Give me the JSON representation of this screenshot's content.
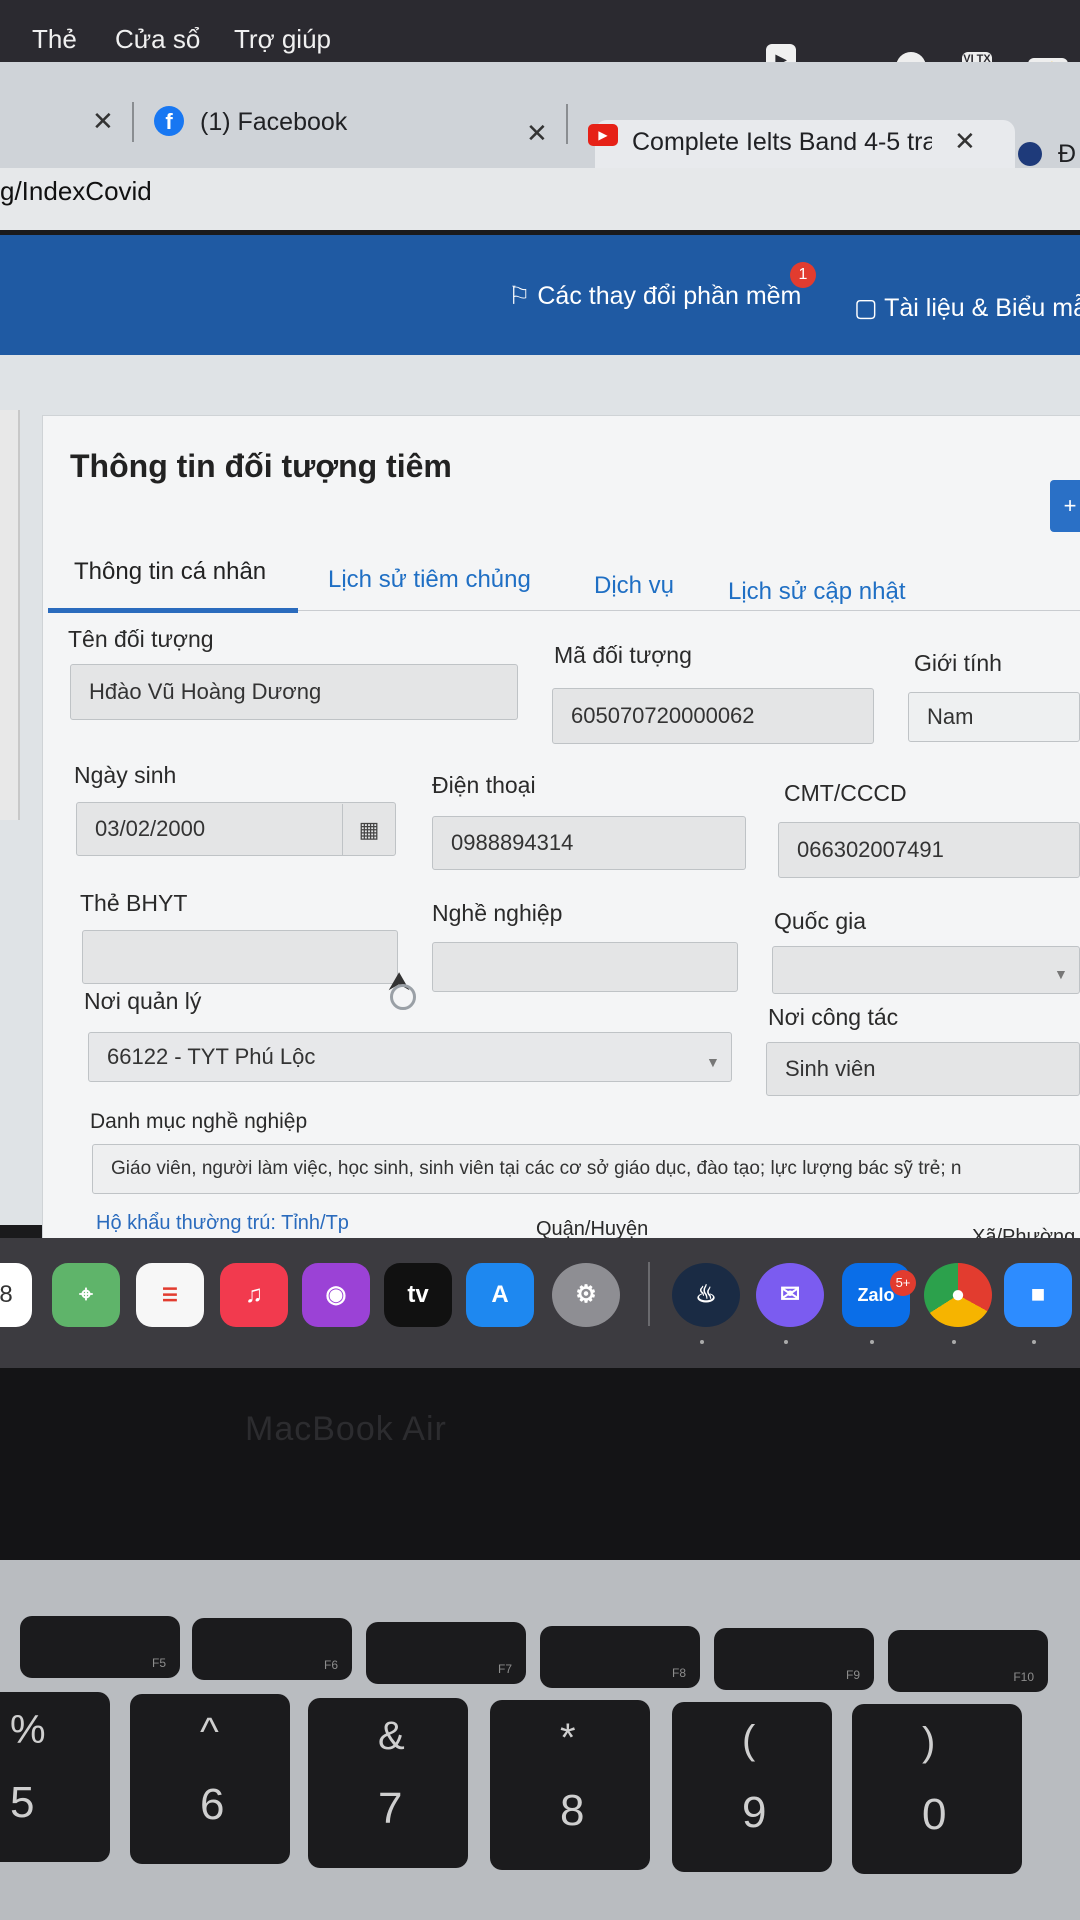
{
  "menubar": {
    "items": [
      "Thẻ",
      "Cửa sổ",
      "Trợ giúp"
    ],
    "input_source": "VI TX"
  },
  "browser": {
    "tabs": [
      {
        "title": "(1) Facebook",
        "icon": "facebook-icon"
      },
      {
        "title": "Complete Ielts Band 4-5 trac",
        "icon": "youtube-icon"
      },
      {
        "title": "Đ",
        "icon": "site-favicon"
      }
    ],
    "url": "g/IndexCovid"
  },
  "app_header": {
    "changes_link": "Các thay đổi phần mềm",
    "changes_badge": "1",
    "docs_link": "Tài liệu & Biểu mẫ"
  },
  "card": {
    "title": "Thông tin đối tượng tiêm",
    "tabs": [
      "Thông tin cá nhân",
      "Lịch sử tiêm chủng",
      "Dịch vụ",
      "Lịch sử cập nhật"
    ]
  },
  "form": {
    "ten_doi_tuong": {
      "label": "Tên đối tượng",
      "value": "Hđào Vũ Hoàng Dương"
    },
    "ma_doi_tuong": {
      "label": "Mã đối tượng",
      "value": "605070720000062"
    },
    "gioi_tinh": {
      "label": "Giới tính",
      "value": "Nam"
    },
    "ngay_sinh": {
      "label": "Ngày sinh",
      "value": "03/02/2000"
    },
    "dien_thoai": {
      "label": "Điện thoại",
      "value": "0988894314"
    },
    "cmt": {
      "label": "CMT/CCCD",
      "value": "066302007491"
    },
    "the_bhyt": {
      "label": "Thẻ BHYT",
      "value": ""
    },
    "nghe_nghiep": {
      "label": "Nghề nghiệp",
      "value": ""
    },
    "quoc_gia": {
      "label": "Quốc gia",
      "value": ""
    },
    "noi_quan_ly": {
      "label": "Nơi quản lý",
      "value": "66122 - TYT Phú Lộc"
    },
    "noi_cong_tac": {
      "label": "Nơi công tác",
      "value": "Sinh viên"
    },
    "danh_muc": {
      "label": "Danh mục nghề nghiệp",
      "value": "Giáo viên, người làm việc, học sinh, sinh viên tại các cơ sở giáo dục, đào tạo; lực lượng bác sỹ trẻ; n"
    },
    "ho_khau": {
      "label_tinh": "Hộ khẩu thường trú: Tỉnh/Tp",
      "label_huyen": "Quận/Huyện",
      "label_xa": "Xã/Phường"
    }
  },
  "dock": {
    "calendar_day": "8",
    "tv_label": "tv",
    "zalo_label": "Zalo",
    "zalo_badge": "5+"
  },
  "laptop": {
    "brand": "MacBook Air",
    "fkeys": [
      "F5",
      "F6",
      "F7",
      "F8",
      "F9",
      "F10"
    ],
    "number_keys": [
      {
        "top": "%",
        "bottom": "5"
      },
      {
        "top": "^",
        "bottom": "6"
      },
      {
        "top": "&",
        "bottom": "7"
      },
      {
        "top": "*",
        "bottom": "8"
      },
      {
        "top": "(",
        "bottom": "9"
      },
      {
        "top": ")",
        "bottom": "0"
      }
    ]
  },
  "colors": {
    "header_blue": "#1f5aa3",
    "link_blue": "#1f6fc4",
    "badge_red": "#e23c2f"
  }
}
